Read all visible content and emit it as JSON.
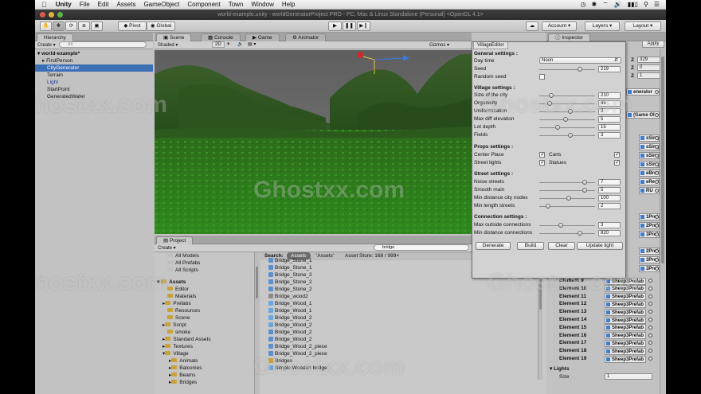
{
  "menubar": {
    "app": "Unity",
    "items": [
      "File",
      "Edit",
      "Assets",
      "GameObject",
      "Component",
      "Town",
      "Window",
      "Help"
    ],
    "clock_icon": "clock-icon"
  },
  "window": {
    "title": "world-example.unity - worldGeneratorProject PRO - PC, Mac & Linux Standalone (Personal) <OpenGL 4.1>"
  },
  "toolbar": {
    "pivot": "Pivot",
    "global": "Global",
    "account": "Account",
    "layers": "Layers",
    "layout": "Layout"
  },
  "hierarchy": {
    "tab": "Hierarchy",
    "create": "Create",
    "search_placeholder": "All",
    "scene": "world-example*",
    "items": [
      "FirstPerson",
      "CityGenerator",
      "Terrain",
      "Light",
      "StartPoint",
      "GeneratedWater"
    ]
  },
  "scene_view": {
    "tabs": [
      "Scene",
      "Console",
      "Game",
      "Animator"
    ],
    "shading": "Shaded",
    "mode_2d": "2D",
    "gizmos": "Gizmos",
    "search_placeholder": "All"
  },
  "village_editor": {
    "tab": "VillageEditor",
    "general": {
      "heading": "General settings :",
      "day_time_label": "Day time",
      "day_time_value": "Noon",
      "seed_label": "Seed",
      "seed_value": "219",
      "random_seed_label": "Random seed"
    },
    "village": {
      "heading": "Village settings :",
      "rows": [
        {
          "label": "Size of the city",
          "value": "210"
        },
        {
          "label": "Organicity",
          "value": "45"
        },
        {
          "label": "Uniformization",
          "value": "3"
        },
        {
          "label": "Max diff elevation",
          "value": "5"
        },
        {
          "label": "Lot depth",
          "value": "15"
        },
        {
          "label": "Fields",
          "value": "3"
        }
      ]
    },
    "props": {
      "heading": "Props settings :",
      "center_place": "Center Place",
      "carts": "Carts",
      "street_lights": "Street lights",
      "statues": "Statues"
    },
    "street": {
      "heading": "Street settings :",
      "rows": [
        {
          "label": "Noise streets",
          "value": "7"
        },
        {
          "label": "Smooth main",
          "value": "5"
        },
        {
          "label": "Min distance city nodes",
          "value": "100"
        },
        {
          "label": "Min length streets",
          "value": "2"
        }
      ]
    },
    "connection": {
      "heading": "Connection settings :",
      "rows": [
        {
          "label": "Max outside connections",
          "value": "3"
        },
        {
          "label": "Min distance connections",
          "value": "820"
        }
      ]
    },
    "buttons": {
      "generate": "Generate",
      "build": "Build",
      "clear": "Clear",
      "update_light": "Update light"
    }
  },
  "inspector": {
    "tab": "Inspector",
    "apply": "Apply",
    "z_label": "Z",
    "z_values": [
      "329",
      "0",
      "1"
    ],
    "partials": [
      "enerator",
      "(Game Ol",
      "sSimpleYell",
      "sSimpleRec",
      "sSimpleBro",
      "sSimpleYell",
      "eBrown2Flc",
      "eRed2Floor",
      "RU",
      "1Prefab",
      "2Prefab",
      "3Prefab",
      "2Prefab",
      "3Prefab",
      "3Prefab"
    ],
    "elements": [
      {
        "label": "Element 9",
        "value": "Sheep3Prefab"
      },
      {
        "label": "Element 10",
        "value": "Sheep3Prefab"
      },
      {
        "label": "Element 11",
        "value": "Sheep3Prefab"
      },
      {
        "label": "Element 12",
        "value": "Sheep3Prefab"
      },
      {
        "label": "Element 13",
        "value": "Sheep3Prefab"
      },
      {
        "label": "Element 14",
        "value": "Sheep3Prefab"
      },
      {
        "label": "Element 15",
        "value": "Sheep3Prefab"
      },
      {
        "label": "Element 16",
        "value": "Sheep3Prefab"
      },
      {
        "label": "Element 17",
        "value": "Sheep3Prefab"
      },
      {
        "label": "Element 18",
        "value": "Sheep3Prefab"
      },
      {
        "label": "Element 19",
        "value": "Sheep3Prefab"
      }
    ],
    "lights_label": "Lights",
    "size_label": "Size",
    "size_value": "1"
  },
  "project": {
    "tab": "Project",
    "create": "Create",
    "search_value": "bridge",
    "favorites": [
      "All Models",
      "All Prefabs",
      "All Scripts"
    ],
    "assets_root": "Assets",
    "folders": [
      "Editor",
      "Materials",
      "Prefabs",
      "Resources",
      "Scene",
      "Script",
      "smoke",
      "Standard Assets",
      "Textures",
      "Village",
      "Animals",
      "Balconies",
      "Beams",
      "Bridges"
    ],
    "search_label": "Search:",
    "search_scope_assets": "Assets",
    "search_scope_quoted": "'Assets'",
    "asset_store": "Asset Store: 168 / 999+",
    "results": [
      "Bridge_Stone_1",
      "Bridge_Stone_1",
      "Bridge_Stone_2",
      "Bridge_Stone_2",
      "Bridge_Stone_2",
      "Bridge_wood2",
      "Bridge_Wood_1",
      "Bridge_Wood_1",
      "Bridge_Wood_2",
      "Bridge_Wood_2",
      "Bridge_Wood_2",
      "Bridge_Wood_2",
      "Bridge_Wood_2_piece",
      "Bridge_Wood_2_piece",
      "Bridges",
      "Simple Wooden bridge"
    ]
  },
  "watermark": "Ghostxx.com"
}
